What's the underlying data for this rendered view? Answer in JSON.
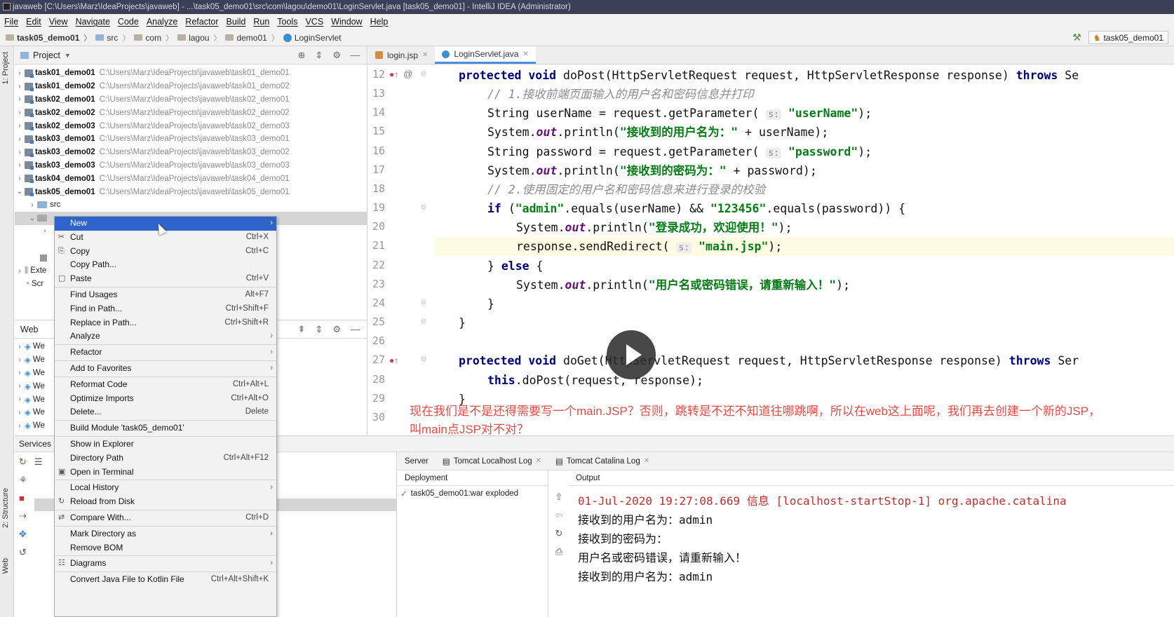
{
  "window": {
    "title": "javaweb [C:\\Users\\Marz\\IdeaProjects\\javaweb] - ...\\task05_demo01\\src\\com\\lagou\\demo01\\LoginServlet.java [task05_demo01] - IntelliJ IDEA (Administrator)"
  },
  "menu": [
    "File",
    "Edit",
    "View",
    "Navigate",
    "Code",
    "Analyze",
    "Refactor",
    "Build",
    "Run",
    "Tools",
    "VCS",
    "Window",
    "Help"
  ],
  "breadcrumb": [
    "task05_demo01",
    "src",
    "com",
    "lagou",
    "demo01",
    "LoginServlet"
  ],
  "run_config": "task05_demo01",
  "left_tabs": {
    "project": "1: Project",
    "structure": "2: Structure",
    "web": "Web"
  },
  "project_panel": {
    "title": "Project",
    "modules": [
      {
        "name": "task01_demo01",
        "path": "C:\\Users\\Marz\\IdeaProjects\\javaweb\\task01_demo01"
      },
      {
        "name": "task01_demo02",
        "path": "C:\\Users\\Marz\\IdeaProjects\\javaweb\\task01_demo02"
      },
      {
        "name": "task02_demo01",
        "path": "C:\\Users\\Marz\\IdeaProjects\\javaweb\\task02_demo01"
      },
      {
        "name": "task02_demo02",
        "path": "C:\\Users\\Marz\\IdeaProjects\\javaweb\\task02_demo02"
      },
      {
        "name": "task02_demo03",
        "path": "C:\\Users\\Marz\\IdeaProjects\\javaweb\\task02_demo03"
      },
      {
        "name": "task03_demo01",
        "path": "C:\\Users\\Marz\\IdeaProjects\\javaweb\\task03_demo01"
      },
      {
        "name": "task03_demo02",
        "path": "C:\\Users\\Marz\\IdeaProjects\\javaweb\\task03_demo02"
      },
      {
        "name": "task03_demo03",
        "path": "C:\\Users\\Marz\\IdeaProjects\\javaweb\\task03_demo03"
      },
      {
        "name": "task04_demo01",
        "path": "C:\\Users\\Marz\\IdeaProjects\\javaweb\\task04_demo01"
      },
      {
        "name": "task05_demo01",
        "path": "C:\\Users\\Marz\\IdeaProjects\\javaweb\\task05_demo01"
      }
    ],
    "src": "src",
    "ext": "Exte",
    "scr": "Scr"
  },
  "web_panel": {
    "title": "Web",
    "item": "We"
  },
  "editor": {
    "tabs": [
      {
        "label": "login.jsp",
        "active": false
      },
      {
        "label": "LoginServlet.java",
        "active": true
      }
    ],
    "line_numbers": [
      "12",
      "13",
      "14",
      "15",
      "16",
      "17",
      "18",
      "19",
      "20",
      "21",
      "22",
      "23",
      "24",
      "25",
      "26",
      "27",
      "28",
      "29",
      "30"
    ],
    "code": {
      "l12_kw": "protected void ",
      "l12_a": "doPost(HttpServletRequest request, HttpServletResponse response) ",
      "l12_kw2": "throws ",
      "l12_b": "Se",
      "l13": "// 1.接收前端页面输入的用户名和密码信息并打印",
      "l14_a": "String userName = request.getParameter( ",
      "l14_hint": "s:",
      "l14_str": " \"userName\"",
      "l14_b": ");",
      "l15_a": "System.",
      "l15_f": "out",
      "l15_b": ".println(",
      "l15_str": "\"接收到的用户名为：\"",
      "l15_c": " + userName);",
      "l16_a": "String password = request.getParameter( ",
      "l16_hint": "s:",
      "l16_str": " \"password\"",
      "l16_b": ");",
      "l17_a": "System.",
      "l17_f": "out",
      "l17_b": ".println(",
      "l17_str": "\"接收到的密码为：\"",
      "l17_c": " + password);",
      "l18": "// 2.使用固定的用户名和密码信息来进行登录的校验",
      "l19_kw": "if ",
      "l19_a": "(",
      "l19_str": "\"admin\"",
      "l19_b": ".equals(userName) && ",
      "l19_str2": "\"123456\"",
      "l19_c": ".equals(password)) {",
      "l20_a": "System.",
      "l20_f": "out",
      "l20_b": ".println(",
      "l20_str": "\"登录成功，欢迎使用！\"",
      "l20_c": ");",
      "l21_a": "response.sendRedirect( ",
      "l21_hint": "s:",
      "l21_str": " \"main.jsp\"",
      "l21_b": ");",
      "l22_a": "} ",
      "l22_kw": "else ",
      "l22_b": "{",
      "l23_a": "System.",
      "l23_f": "out",
      "l23_b": ".println(",
      "l23_str": "\"用户名或密码错误，请重新输入！\"",
      "l23_c": ");",
      "l24": "}",
      "l25": "}",
      "l27_kw": "protected void ",
      "l27_a": "doGet(HttpServletRequest request, HttpServletResponse response) ",
      "l27_kw2": "throws ",
      "l27_b": "Ser",
      "l28_kw": "this",
      "l28_a": ".doPost(request, response);",
      "l29": "}"
    }
  },
  "subtitle": "现在我们是不是还得需要写一个main.JSP？否则，跳转是不还不知道往哪跳啊，所以在web这上面呢，我们再去创建一个新的JSP，叫main点JSP对不对？",
  "context_menu": {
    "items": [
      {
        "label": "New",
        "shortcut": "",
        "sub": true,
        "selected": true
      },
      {
        "label": "Cut",
        "shortcut": "Ctrl+X",
        "icon": "✂"
      },
      {
        "label": "Copy",
        "shortcut": "Ctrl+C",
        "icon": "⎘"
      },
      {
        "label": "Copy Path...",
        "shortcut": ""
      },
      {
        "label": "Paste",
        "shortcut": "Ctrl+V",
        "icon": "▢"
      },
      {
        "sep": true
      },
      {
        "label": "Find Usages",
        "shortcut": "Alt+F7"
      },
      {
        "label": "Find in Path...",
        "shortcut": "Ctrl+Shift+F"
      },
      {
        "label": "Replace in Path...",
        "shortcut": "Ctrl+Shift+R"
      },
      {
        "label": "Analyze",
        "sub": true
      },
      {
        "sep": true
      },
      {
        "label": "Refactor",
        "sub": true
      },
      {
        "sep": true
      },
      {
        "label": "Add to Favorites",
        "sub": true
      },
      {
        "sep": true
      },
      {
        "label": "Reformat Code",
        "shortcut": "Ctrl+Alt+L"
      },
      {
        "label": "Optimize Imports",
        "shortcut": "Ctrl+Alt+O"
      },
      {
        "label": "Delete...",
        "shortcut": "Delete"
      },
      {
        "sep": true
      },
      {
        "label": "Build Module 'task05_demo01'",
        "shortcut": ""
      },
      {
        "sep": true
      },
      {
        "label": "Show in Explorer",
        "shortcut": ""
      },
      {
        "label": "Directory Path",
        "shortcut": "Ctrl+Alt+F12"
      },
      {
        "label": "Open in Terminal",
        "shortcut": "",
        "icon": "▣"
      },
      {
        "sep": true
      },
      {
        "label": "Local History",
        "sub": true
      },
      {
        "label": "Reload from Disk",
        "shortcut": "",
        "icon": "↻"
      },
      {
        "sep": true
      },
      {
        "label": "Compare With...",
        "shortcut": "Ctrl+D",
        "icon": "⇄"
      },
      {
        "sep": true
      },
      {
        "label": "Mark Directory as",
        "sub": true
      },
      {
        "label": "Remove BOM",
        "shortcut": ""
      },
      {
        "sep": true
      },
      {
        "label": "Diagrams",
        "sub": true,
        "icon": "☷"
      },
      {
        "sep": true
      },
      {
        "label": "Convert Java File to Kotlin File",
        "shortcut": "Ctrl+Alt+Shift+K"
      }
    ]
  },
  "services": {
    "title": "Services",
    "tabs": [
      "Server",
      "Tomcat Localhost Log",
      "Tomcat Catalina Log"
    ],
    "deployment_header": "Deployment",
    "output_header": "Output",
    "deployment_item": "task05_demo01:war exploded",
    "output_lines": [
      {
        "text": "01-Jul-2020 19:27:08.669 信息 [localhost-startStop-1] org.apache.catalina",
        "red": true
      },
      {
        "text": "接收到的用户名为：admin",
        "red": false
      },
      {
        "text": "接收到的密码为：",
        "red": false
      },
      {
        "text": "用户名或密码错误，请重新输入！",
        "red": false
      },
      {
        "text": "接收到的用户名为：admin",
        "red": false
      }
    ]
  }
}
